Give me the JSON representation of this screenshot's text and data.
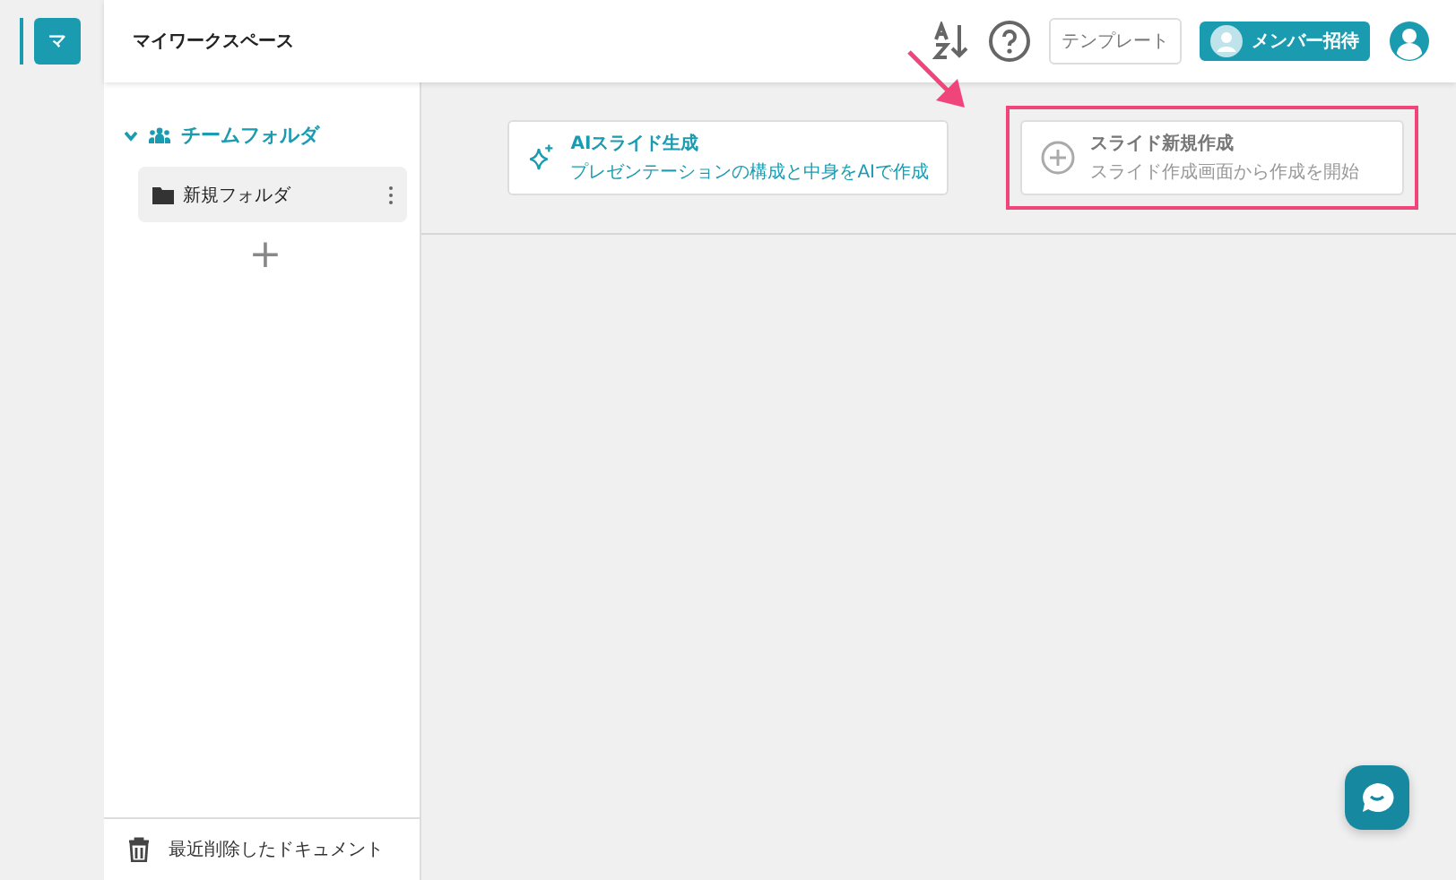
{
  "workspaces": [
    {
      "letter": "マ",
      "selected": true
    }
  ],
  "header": {
    "title": "マイワークスペース",
    "template_button": "テンプレート",
    "invite_button": "メンバー招待"
  },
  "sidebar": {
    "folder_group": {
      "label": "チームフォルダ",
      "expanded": true,
      "children": [
        {
          "label": "新規フォルダ",
          "selected": true
        }
      ]
    },
    "add_button": "+",
    "trash": "最近削除したドキュメント"
  },
  "actions": [
    {
      "kind": "ai",
      "title": "AIスライド生成",
      "subtitle": "プレゼンテーションの構成と中身をAIで作成",
      "highlighted": false
    },
    {
      "kind": "new",
      "title": "スライド新規作成",
      "subtitle": "スライド作成画面から作成を開始",
      "highlighted": true
    }
  ]
}
